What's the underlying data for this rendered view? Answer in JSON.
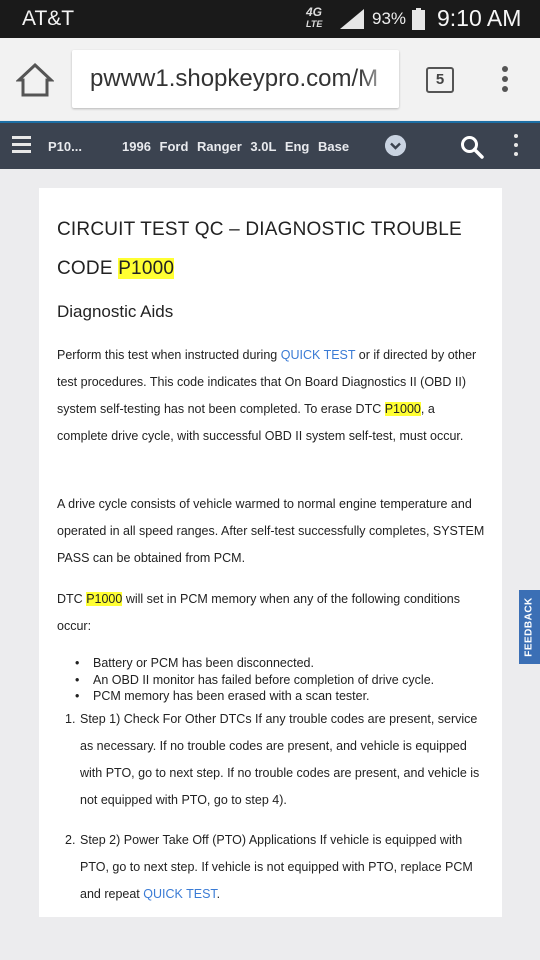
{
  "status_bar": {
    "carrier": "AT&T",
    "network": "4G",
    "network_sub": "LTE",
    "battery": "93%",
    "time": "9:10 AM"
  },
  "browser": {
    "url": "pwww1.shopkeypro.com/M",
    "tab_count": "5",
    "home_icon": "home-icon",
    "menu_icon": "vertical-dots-icon"
  },
  "app_header": {
    "code_short": "P10...",
    "vehicle": "1996 Ford Ranger 3.0L Eng Base",
    "menu_icon": "hamburger-icon",
    "dropdown_icon": "chevron-down-icon",
    "search_icon": "search-icon",
    "more_icon": "vertical-dots-icon",
    "accent_color": "#1d6fa5",
    "header_color": "#3b4350"
  },
  "document": {
    "title_prefix": "CIRCUIT TEST QC – DIAGNOSTIC TROUBLE CODE",
    "title_code": "P1000",
    "section_title": "Diagnostic Aids",
    "p1": {
      "a": "Perform this test when instructed during",
      "link": "QUICK TEST",
      "b": "or if directed by other test procedures. This code indicates that On Board Diagnostics II (OBD II) system self-testing has not been completed. To erase DTC",
      "code": "P1000",
      "c": ", a complete drive cycle, with successful OBD II system self-test, must occur."
    },
    "p2": "A drive cycle consists of vehicle warmed to normal engine temperature and operated in all speed ranges. After self-test successfully completes, SYSTEM PASS can be obtained from PCM.",
    "p3": {
      "a": "DTC",
      "code": "P1000",
      "b": "will set in PCM memory when any of the following conditions occur:"
    },
    "bullets": [
      "Battery or PCM has been disconnected.",
      "An OBD II monitor has failed before completion of drive cycle.",
      "PCM memory has been erased with a scan tester."
    ],
    "steps": [
      {
        "num": "1.",
        "text": "Step 1) Check For Other DTCs  If any trouble codes are present, service as necessary. If no trouble codes are present, and vehicle is equipped with PTO, go to next step. If no trouble codes are present, and vehicle is not equipped with PTO, go to step 4)."
      },
      {
        "num": "2.",
        "text_a": "Step 2) Power Take Off (PTO) Applications  If vehicle is equipped with PTO, go to next step. If vehicle is not equipped with PTO, replace PCM and repeat",
        "link": "QUICK TEST",
        "text_b": "."
      }
    ],
    "highlight_color": "#ffff33",
    "link_color": "#3a7bd5"
  },
  "feedback": {
    "label": "FEEDBACK",
    "color": "#3b6fb5"
  }
}
